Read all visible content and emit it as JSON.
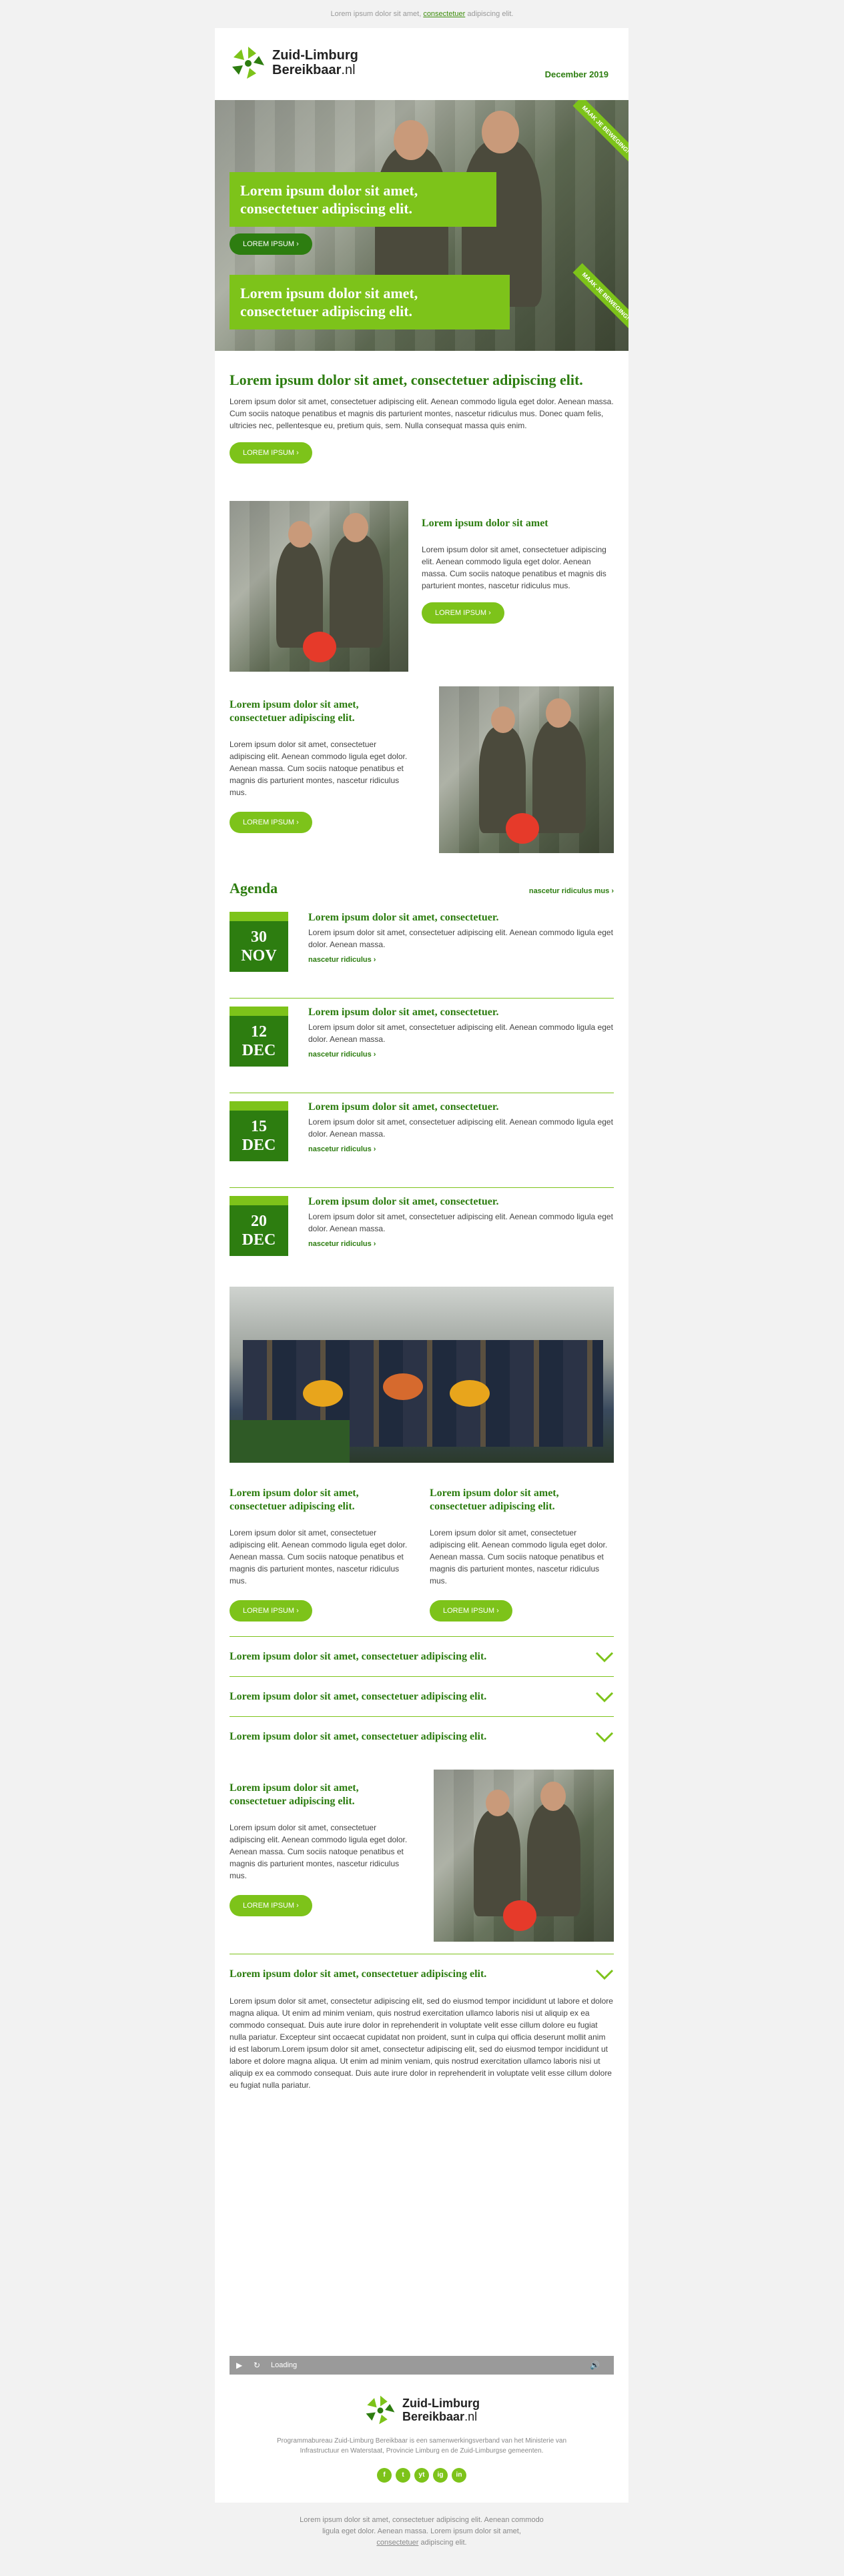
{
  "preheader": {
    "text_before": "Lorem ipsum dolor sit amet,",
    "link": "consectetuer",
    "text_after": "adipiscing elit."
  },
  "header": {
    "logo_line1": "Zuid-Limburg",
    "logo_line2": "Bereikbaar",
    "logo_suffix": ".nl",
    "date": "December 2019"
  },
  "hero": {
    "title1": "Lorem ipsum dolor sit amet, consectetuer adipiscing elit.",
    "button": "LOREM IPSUM ›",
    "title2": "Lorem ipsum dolor sit amet, consectetuer adipiscing elit.",
    "ribbon1": "MAAK JE BEWEGING!",
    "ribbon2": "MAAK JE BEWEGING!"
  },
  "intro": {
    "title": "Lorem ipsum dolor sit amet, consectetuer adipiscing elit.",
    "body": "Lorem ipsum dolor sit amet, consectetuer adipiscing elit. Aenean commodo ligula eget dolor. Aenean massa. Cum sociis natoque penatibus et magnis dis parturient montes, nascetur ridiculus mus. Donec quam felis, ultricies nec, pellentesque eu, pretium quis, sem. Nulla consequat massa quis enim.",
    "button": "LOREM IPSUM ›"
  },
  "feature1": {
    "title": "Lorem ipsum dolor sit amet",
    "body": "Lorem ipsum dolor sit amet, consectetuer adipiscing elit. Aenean commodo ligula eget dolor. Aenean massa. Cum sociis natoque penatibus et magnis dis parturient montes, nascetur ridiculus mus.",
    "button": "LOREM IPSUM ›"
  },
  "feature2": {
    "title": "Lorem ipsum dolor sit amet, consectetuer adipiscing elit.",
    "body": "Lorem ipsum dolor sit amet, consectetuer adipiscing elit. Aenean commodo ligula eget dolor. Aenean massa. Cum sociis natoque penatibus et magnis dis parturient montes, nascetur ridiculus mus.",
    "button": "LOREM IPSUM ›"
  },
  "agenda": {
    "title": "Agenda",
    "more": "nascetur ridiculus mus ›",
    "events": [
      {
        "day": "30",
        "month": "NOV",
        "title": "Lorem ipsum dolor sit amet, consectetuer.",
        "body": "Lorem ipsum dolor sit amet, consectetuer adipiscing elit. Aenean commodo ligula eget dolor. Aenean massa.",
        "link": "nascetur ridiculus ›"
      },
      {
        "day": "12",
        "month": "DEC",
        "title": "Lorem ipsum dolor sit amet, consectetuer.",
        "body": "Lorem ipsum dolor sit amet, consectetuer adipiscing elit. Aenean commodo ligula eget dolor. Aenean massa.",
        "link": "nascetur ridiculus ›"
      },
      {
        "day": "15",
        "month": "DEC",
        "title": "Lorem ipsum dolor sit amet, consectetuer.",
        "body": "Lorem ipsum dolor sit amet, consectetuer adipiscing elit. Aenean commodo ligula eget dolor. Aenean massa.",
        "link": "nascetur ridiculus ›"
      },
      {
        "day": "20",
        "month": "DEC",
        "title": "Lorem ipsum dolor sit amet, consectetuer.",
        "body": "Lorem ipsum dolor sit amet, consectetuer adipiscing elit. Aenean commodo ligula eget dolor. Aenean massa.",
        "link": "nascetur ridiculus ›"
      }
    ]
  },
  "columns": [
    {
      "title": "Lorem ipsum dolor sit amet, consectetuer adipiscing elit.",
      "body": "Lorem ipsum dolor sit amet, consectetuer adipiscing elit. Aenean commodo ligula eget dolor. Aenean massa. Cum sociis natoque penatibus et magnis dis parturient montes, nascetur ridiculus mus.",
      "button": "LOREM IPSUM ›"
    },
    {
      "title": "Lorem ipsum dolor sit amet, consectetuer adipiscing elit.",
      "body": "Lorem ipsum dolor sit amet, consectetuer adipiscing elit. Aenean commodo ligula eget dolor. Aenean massa. Cum sociis natoque penatibus et magnis dis parturient montes, nascetur ridiculus mus.",
      "button": "LOREM IPSUM ›"
    }
  ],
  "accordion": [
    "Lorem ipsum dolor sit amet, consectetuer adipiscing elit.",
    "Lorem ipsum dolor sit amet, consectetuer adipiscing elit.",
    "Lorem ipsum dolor sit amet, consectetuer adipiscing elit."
  ],
  "feature3": {
    "title": "Lorem ipsum dolor sit amet, consectetuer adipiscing elit.",
    "body": "Lorem ipsum dolor sit amet, consectetuer adipiscing elit. Aenean commodo ligula eget dolor. Aenean massa. Cum sociis natoque penatibus et magnis dis parturient montes, nascetur ridiculus mus.",
    "button": "LOREM IPSUM ›"
  },
  "accordion2": "Lorem ipsum dolor sit amet, consectetuer adipiscing elit.",
  "longtext": "Lorem ipsum dolor sit amet, consectetur adipiscing elit, sed do eiusmod tempor incididunt ut labore et dolore magna aliqua. Ut enim ad minim veniam, quis nostrud exercitation ullamco laboris nisi ut aliquip ex ea commodo consequat. Duis aute irure dolor in reprehenderit in voluptate velit esse cillum dolore eu fugiat nulla pariatur. Excepteur sint occaecat cupidatat non proident, sunt in culpa qui officia deserunt mollit anim id est laborum.Lorem ipsum dolor sit amet, consectetur adipiscing elit, sed do eiusmod tempor incididunt ut labore et dolore magna aliqua. Ut enim ad minim veniam, quis nostrud exercitation ullamco laboris nisi ut aliquip ex ea commodo consequat. Duis aute irure dolor in reprehenderit in voluptate velit esse cillum dolore eu fugiat nulla pariatur.",
  "player": {
    "status": "Loading"
  },
  "footer": {
    "text": "Programmabureau Zuid-Limburg Bereikbaar is een samenwerkingsverband van het Ministerie van Infrastructuur en Waterstaat, Provincie Limburg en de Zuid-Limburgse gemeenten.",
    "social": [
      "f",
      "t",
      "yt",
      "ig",
      "in"
    ]
  },
  "bottom": {
    "line1": "Lorem ipsum dolor sit amet, consectetuer adipiscing elit. Aenean commodo",
    "line2": "ligula eget dolor. Aenean massa. Lorem ipsum dolor sit amet,",
    "link": "consectetuer",
    "after": "adipiscing elit."
  },
  "colors": {
    "green": "#7dc31a",
    "darkgreen": "#2d7d10"
  }
}
